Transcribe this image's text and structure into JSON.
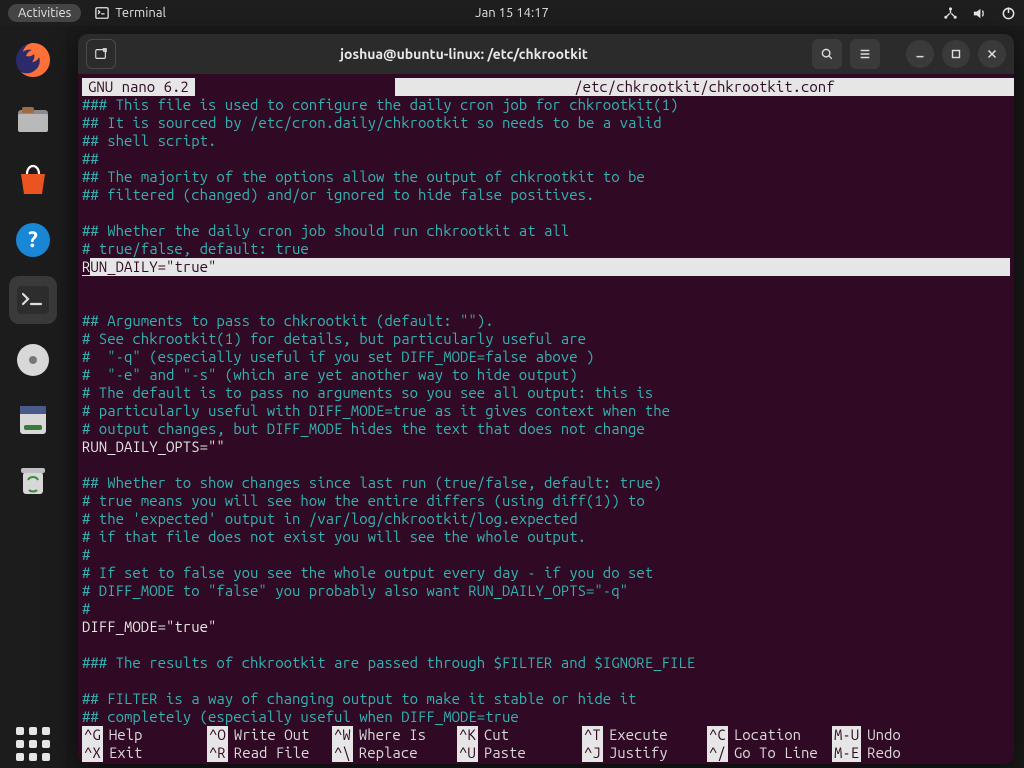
{
  "menubar": {
    "activities": "Activities",
    "app": "Terminal",
    "clock": "Jan 15  14:17"
  },
  "window": {
    "title": "joshua@ubuntu-linux: /etc/chkrootkit"
  },
  "nano": {
    "version": "GNU  nano  6.2",
    "filepath": "/etc/chkrootkit/chkrootkit.conf",
    "lines": [
      {
        "t": "cmt",
        "s": "### This file is used to configure the daily cron job for chkrootkit(1)"
      },
      {
        "t": "cmt",
        "s": "## It is sourced by /etc/cron.daily/chkrootkit so needs to be a valid"
      },
      {
        "t": "cmt",
        "s": "## shell script."
      },
      {
        "t": "cmt",
        "s": "##"
      },
      {
        "t": "cmt",
        "s": "## The majority of the options allow the output of chkrootkit to be"
      },
      {
        "t": "cmt",
        "s": "## filtered (changed) and/or ignored to hide false positives."
      },
      {
        "t": "blank",
        "s": ""
      },
      {
        "t": "cmt",
        "s": "## Whether the daily cron job should run chkrootkit at all"
      },
      {
        "t": "cmt",
        "s": "# true/false, default: true"
      },
      {
        "t": "cursor",
        "s": "RUN_DAILY=\"true\""
      },
      {
        "t": "blank",
        "s": ""
      },
      {
        "t": "cmt",
        "s": "## Arguments to pass to chkrootkit (default: \"\")."
      },
      {
        "t": "cmt",
        "s": "# See chkrootkit(1) for details, but particularly useful are"
      },
      {
        "t": "cmt",
        "s": "#  \"-q\" (especially useful if you set DIFF_MODE=false above )"
      },
      {
        "t": "cmt",
        "s": "#  \"-e\" and \"-s\" (which are yet another way to hide output)"
      },
      {
        "t": "cmt",
        "s": "# The default is to pass no arguments so you see all output: this is"
      },
      {
        "t": "cmt",
        "s": "# particularly useful with DIFF_MODE=true as it gives context when the"
      },
      {
        "t": "cmt",
        "s": "# output changes, but DIFF_MODE hides the text that does not change"
      },
      {
        "t": "code",
        "s": "RUN_DAILY_OPTS=\"\""
      },
      {
        "t": "blank",
        "s": ""
      },
      {
        "t": "cmt",
        "s": "## Whether to show changes since last run (true/false, default: true)"
      },
      {
        "t": "cmt",
        "s": "# true means you will see how the entire differs (using diff(1)) to"
      },
      {
        "t": "cmt",
        "s": "# the 'expected' output in /var/log/chkrootkit/log.expected"
      },
      {
        "t": "cmt",
        "s": "# if that file does not exist you will see the whole output."
      },
      {
        "t": "cmt",
        "s": "#"
      },
      {
        "t": "cmt",
        "s": "# If set to false you see the whole output every day - if you do set"
      },
      {
        "t": "cmt",
        "s": "# DIFF_MODE to \"false\" you probably also want RUN_DAILY_OPTS=\"-q\""
      },
      {
        "t": "cmt",
        "s": "#"
      },
      {
        "t": "code",
        "s": "DIFF_MODE=\"true\""
      },
      {
        "t": "blank",
        "s": ""
      },
      {
        "t": "cmt",
        "s": "### The results of chkrootkit are passed through $FILTER and $IGNORE_FILE"
      },
      {
        "t": "blank",
        "s": ""
      },
      {
        "t": "cmt",
        "s": "## FILTER is a way of changing output to make it stable or hide it"
      },
      {
        "t": "cmt",
        "s": "## completely (especially useful when DIFF_MODE=true"
      }
    ],
    "footer": [
      [
        {
          "k": "^G",
          "l": "Help"
        },
        {
          "k": "^O",
          "l": "Write Out"
        },
        {
          "k": "^W",
          "l": "Where Is"
        },
        {
          "k": "^K",
          "l": "Cut"
        },
        {
          "k": "^T",
          "l": "Execute"
        },
        {
          "k": "^C",
          "l": "Location"
        },
        {
          "k": "M-U",
          "l": "Undo"
        }
      ],
      [
        {
          "k": "^X",
          "l": "Exit"
        },
        {
          "k": "^R",
          "l": "Read File"
        },
        {
          "k": "^\\",
          "l": "Replace"
        },
        {
          "k": "^U",
          "l": "Paste"
        },
        {
          "k": "^J",
          "l": "Justify"
        },
        {
          "k": "^/",
          "l": "Go To Line"
        },
        {
          "k": "M-E",
          "l": "Redo"
        }
      ]
    ]
  }
}
